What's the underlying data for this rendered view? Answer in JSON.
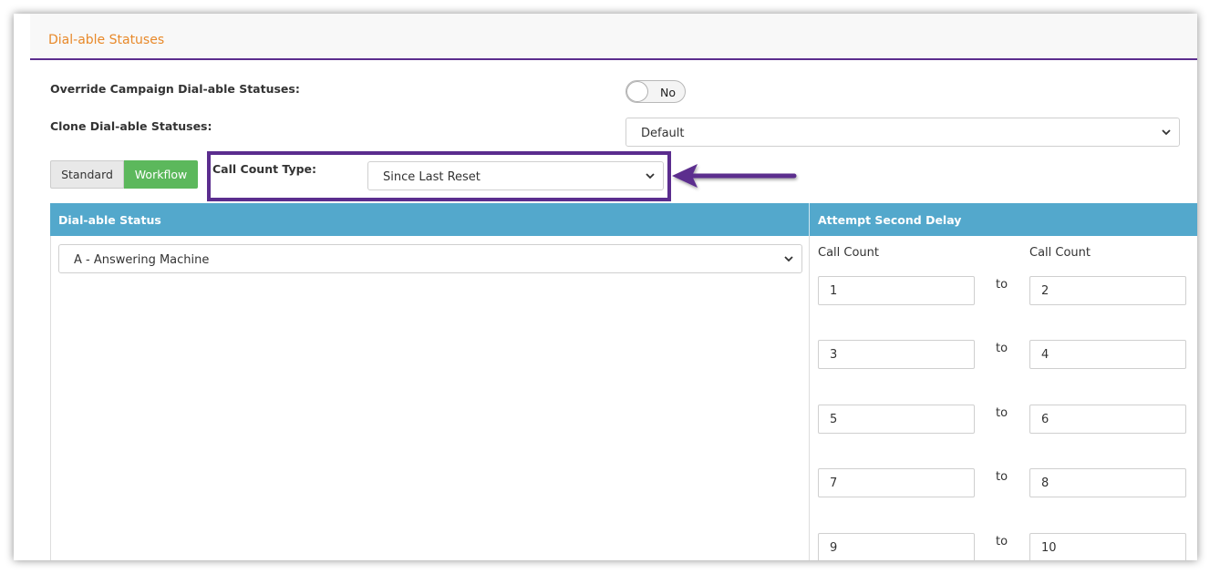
{
  "panel": {
    "title": "Dial-able Statuses"
  },
  "override": {
    "label": "Override Campaign Dial-able Statuses:",
    "toggle_value": "No"
  },
  "clone": {
    "label": "Clone Dial-able Statuses:",
    "selected": "Default"
  },
  "mode_buttons": {
    "standard": "Standard",
    "workflow": "Workflow",
    "active": "Workflow"
  },
  "call_count_type": {
    "label": "Call Count Type:",
    "selected": "Since Last Reset"
  },
  "table": {
    "col_status": "Dial-able Status",
    "col_delay": "Attempt Second Delay",
    "status_selected": "A - Answering Machine",
    "call_count_label_from": "Call Count",
    "call_count_label_to": "Call Count",
    "to_text": "to",
    "ranges": [
      {
        "from": "1",
        "to": "2"
      },
      {
        "from": "3",
        "to": "4"
      },
      {
        "from": "5",
        "to": "6"
      },
      {
        "from": "7",
        "to": "8"
      },
      {
        "from": "9",
        "to": "10"
      }
    ]
  },
  "colors": {
    "accent_orange": "#e8892a",
    "accent_purple": "#5b2d8e",
    "header_blue": "#53a8cc",
    "workflow_green": "#5cb85c"
  },
  "icons": {
    "select_caret": "chevron-down-icon",
    "annotation": "left-arrow-icon"
  }
}
